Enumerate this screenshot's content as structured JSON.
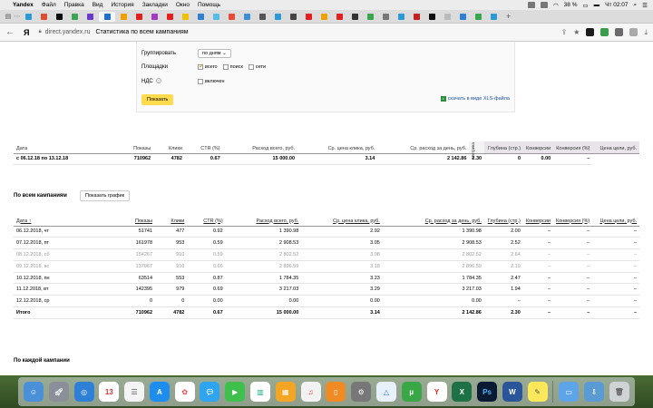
{
  "menubar": {
    "app": "Yandex",
    "items": [
      "Файл",
      "Правка",
      "Вид",
      "История",
      "Закладки",
      "Окно",
      "Помощь"
    ],
    "battery": "38 %",
    "clock": "Чт 02:07"
  },
  "addressbar": {
    "ya_logo": "Я",
    "host": "direct.yandex.ru",
    "page_title": "Статистика по всем кампаниям"
  },
  "settings": {
    "grouping_label": "Группировать",
    "grouping_value": "по дням",
    "platforms_label": "Площадки",
    "platforms": [
      {
        "label": "всего",
        "checked": true
      },
      {
        "label": "поиск",
        "checked": false
      },
      {
        "label": "сети",
        "checked": false
      }
    ],
    "vat_label": "НДС",
    "vat_option": "включен",
    "show_button": "Показать",
    "xls_link": "скачать в виде XLS-файла"
  },
  "summary": {
    "headers": [
      "Дата",
      "Показы",
      "Клики",
      "CTR (%)",
      "Расход всего, руб.",
      "Ср. цена клика, руб.",
      "Ср. расход за день, руб.",
      "Метрика",
      "Глубина (стр.)",
      "Конверсии",
      "Конверсия (%)",
      "Цена цели, руб."
    ],
    "row": [
      "с 06.12.18 по 13.12.18",
      "710962",
      "4782",
      "0.67",
      "15 000.00",
      "3.14",
      "2 142.86",
      "2.30",
      "0",
      "0.00",
      "–"
    ]
  },
  "all_campaigns": {
    "title": "По всем кампаниям",
    "graph_button": "Показать график",
    "headers": [
      "Дата ↑",
      "Показы",
      "Клики",
      "CTR (%)",
      "Расход всего, руб.",
      "Ср. цена клика, руб.",
      "Ср. расход за день, руб.",
      "Глубина (стр.)",
      "Конверсии",
      "Конверсия (%)",
      "Цена цели, руб."
    ],
    "rows": [
      {
        "cells": [
          "06.12.2018, чт",
          "51741",
          "477",
          "0.92",
          "1 390.98",
          "2.92",
          "1 390.98",
          "2.00",
          "–",
          "–",
          "–"
        ],
        "weekend": false
      },
      {
        "cells": [
          "07.12.2018, пт",
          "161978",
          "953",
          "0.59",
          "2 908.53",
          "3.05",
          "2 908.53",
          "2.52",
          "–",
          "–",
          "–"
        ],
        "weekend": false
      },
      {
        "cells": [
          "08.12.2018, сб",
          "154267",
          "910",
          "0.59",
          "2 802.52",
          "3.08",
          "2 802.52",
          "2.64",
          "–",
          "–",
          "–"
        ],
        "weekend": true
      },
      {
        "cells": [
          "09.12.2018, вс",
          "137067",
          "910",
          "0.66",
          "2 896.59",
          "3.18",
          "2 896.59",
          "2.19",
          "–",
          "–",
          "–"
        ],
        "weekend": true
      },
      {
        "cells": [
          "10.12.2018, пн",
          "63514",
          "553",
          "0.87",
          "1 784.35",
          "3.23",
          "1 784.35",
          "2.47",
          "–",
          "–",
          "–"
        ],
        "weekend": false
      },
      {
        "cells": [
          "11.12.2018, вт",
          "142395",
          "979",
          "0.69",
          "3 217.03",
          "3.29",
          "3 217.03",
          "1.94",
          "–",
          "–",
          "–"
        ],
        "weekend": false
      },
      {
        "cells": [
          "12.12.2018, ср",
          "0",
          "0",
          "0.00",
          "0.00",
          "0.00",
          "0.00",
          "–",
          "–",
          "–",
          "–"
        ],
        "weekend": false
      }
    ],
    "total": [
      "Итого",
      "710962",
      "4782",
      "0.67",
      "15 000.00",
      "3.14",
      "2 142.86",
      "2.30",
      "–",
      "–",
      "–"
    ]
  },
  "each_campaign": {
    "title": "По каждой кампании"
  }
}
